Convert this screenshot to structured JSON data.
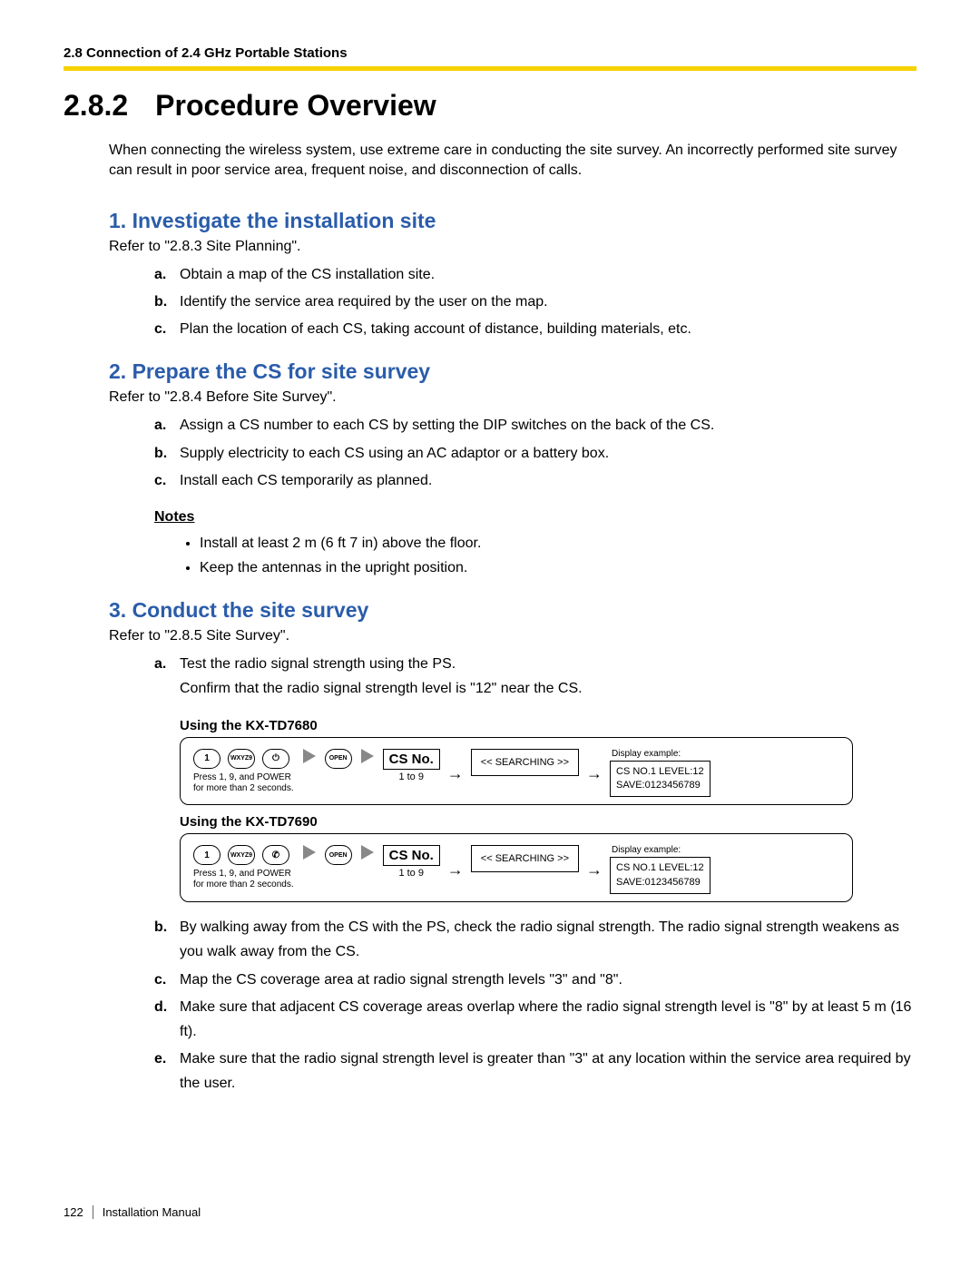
{
  "header": "2.8 Connection of 2.4 GHz Portable Stations",
  "section_number": "2.8.2",
  "section_title": "Procedure Overview",
  "intro": "When connecting the wireless system, use extreme care in conducting the site survey. An incorrectly performed site survey can result in poor service area, frequent noise, and disconnection of calls.",
  "s1": {
    "title": "1. Investigate the installation site",
    "refer": "Refer to \"2.8.3 Site Planning\".",
    "items": [
      "Obtain a map of the CS installation site.",
      "Identify the service area required by the user on the map.",
      "Plan the location of each CS, taking account of distance, building materials, etc."
    ]
  },
  "s2": {
    "title": "2. Prepare the CS for site survey",
    "refer": "Refer to \"2.8.4 Before Site Survey\".",
    "items": [
      "Assign a CS number to each CS by setting the DIP switches on the back of the CS.",
      "Supply electricity to each CS using an AC adaptor or a battery box.",
      "Install each CS temporarily as planned."
    ],
    "notes_title": "Notes",
    "notes": [
      "Install at least 2 m (6 ft 7 in) above the floor.",
      "Keep the antennas in the upright position."
    ]
  },
  "s3": {
    "title": "3. Conduct the site survey",
    "refer": "Refer to \"2.8.5 Site Survey\".",
    "item_a_line1": "Test the radio signal strength using the PS.",
    "item_a_line2": "Confirm that the radio signal strength level is \"12\" near the CS.",
    "device1_label": "Using the KX-TD7680",
    "device2_label": "Using the KX-TD7690",
    "press_note": "Press 1, 9, and POWER\nfor more than 2 seconds.",
    "csno_label": "CS No.",
    "csno_range": "1 to 9",
    "searching": "<< SEARCHING >>",
    "display_label": "Display example:",
    "display_line1": "CS NO.1 LEVEL:12",
    "display_line2": "SAVE:0123456789",
    "key1": "1",
    "key9": "WXYZ9",
    "key_open": "OPEN",
    "items_rest": [
      "By walking away from the CS with the PS, check the radio signal strength. The radio signal strength weakens as you walk away from the CS.",
      "Map the CS coverage area at radio signal strength levels \"3\" and \"8\".",
      "Make sure that adjacent CS coverage areas overlap where the radio signal strength level is \"8\" by at least 5 m (16 ft).",
      "Make sure that the radio signal strength level is greater than \"3\" at any location within the service area required by the user."
    ]
  },
  "footer": {
    "page": "122",
    "doc": "Installation Manual"
  },
  "markers": [
    "a.",
    "b.",
    "c.",
    "d.",
    "e."
  ]
}
